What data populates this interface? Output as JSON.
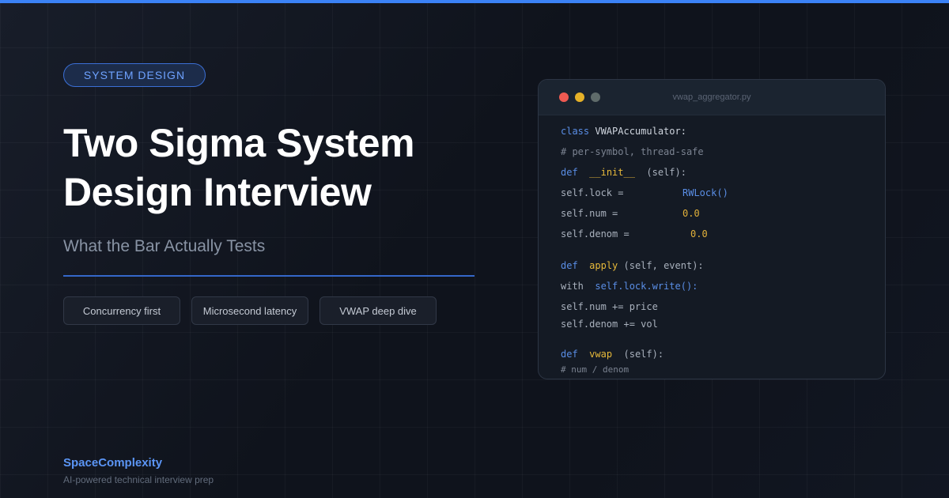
{
  "tag": "SYSTEM DESIGN",
  "title_line1": "Two Sigma System",
  "title_line2": "Design Interview",
  "subtitle": "What the Bar Actually Tests",
  "pills": [
    "Concurrency first",
    "Microsecond latency",
    "VWAP deep dive"
  ],
  "brand": "SpaceComplexity",
  "tagline": "AI-powered technical interview prep",
  "code_window": {
    "filename": "vwap_aggregator.py",
    "lines": {
      "l1_kw": "class",
      "l1_name": "VWAPAccumulator:",
      "l2": "# per-symbol, thread-safe",
      "l3_kw": "def",
      "l3_fn": "__init__",
      "l3_rest": "(self):",
      "l4_lhs": "self.lock =",
      "l4_rhs": "RWLock()",
      "l5_lhs": "self.num =",
      "l5_rhs": "0.0",
      "l6_lhs": "self.denom =",
      "l6_rhs": "0.0",
      "l7_kw": "def",
      "l7_fn": "apply",
      "l7_rest": "(self, event):",
      "l8_kw": "with",
      "l8_call": "self.lock.write():",
      "l9": "self.num += price",
      "l10": "self.denom += vol",
      "l11_kw": "def",
      "l11_fn": "vwap",
      "l11_rest": "(self):",
      "l12": "# num / denom"
    }
  },
  "colors": {
    "accent": "#3b82f6",
    "background": "#0f131c",
    "keyword": "#5a8ee6",
    "function": "#e7b93a"
  }
}
